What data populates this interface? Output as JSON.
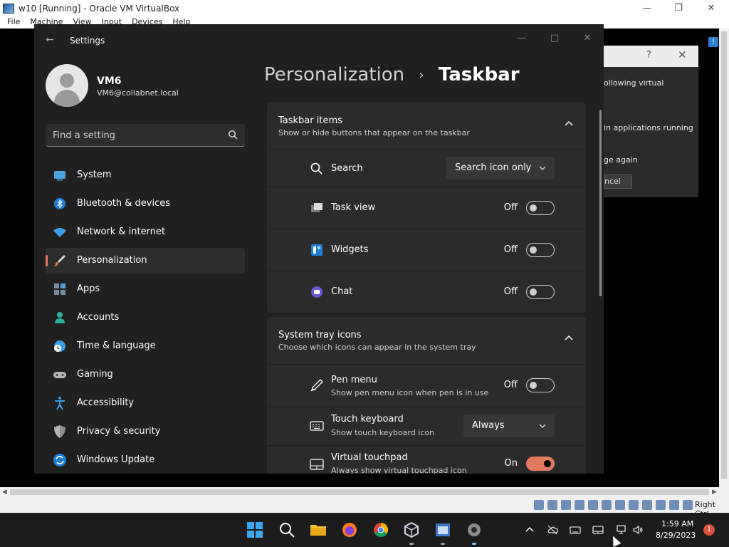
{
  "host": {
    "title": "w10 [Running] - Oracle VM VirtualBox",
    "menu": [
      "File",
      "Machine",
      "View",
      "Input",
      "Devices",
      "Help"
    ],
    "status_right": "Right Ctrl"
  },
  "bg_dialog": {
    "help": "?",
    "line1": "ollowing virtual",
    "line2": "in applications running",
    "line3": "ge again",
    "cancel": "ncel"
  },
  "settings": {
    "window_title": "Settings",
    "user": {
      "name": "VM6",
      "email": "VM6@collabnet.local"
    },
    "search": {
      "placeholder": "Find a setting"
    },
    "nav": [
      {
        "label": "System",
        "icon": "system-icon"
      },
      {
        "label": "Bluetooth & devices",
        "icon": "bluetooth-icon"
      },
      {
        "label": "Network & internet",
        "icon": "wifi-icon"
      },
      {
        "label": "Personalization",
        "icon": "brush-icon",
        "active": true
      },
      {
        "label": "Apps",
        "icon": "apps-icon"
      },
      {
        "label": "Accounts",
        "icon": "accounts-icon"
      },
      {
        "label": "Time & language",
        "icon": "clock-globe-icon"
      },
      {
        "label": "Gaming",
        "icon": "gamepad-icon"
      },
      {
        "label": "Accessibility",
        "icon": "accessibility-icon"
      },
      {
        "label": "Privacy & security",
        "icon": "shield-icon"
      },
      {
        "label": "Windows Update",
        "icon": "update-icon"
      }
    ],
    "breadcrumb": {
      "parent": "Personalization",
      "separator": "›",
      "current": "Taskbar"
    },
    "taskbar_items": {
      "title": "Taskbar items",
      "subtitle": "Show or hide buttons that appear on the taskbar",
      "rows": [
        {
          "label": "Search",
          "value": "Search icon only",
          "icon": "search-icon"
        },
        {
          "label": "Task view",
          "state": "Off",
          "on": false,
          "icon": "task-view-icon"
        },
        {
          "label": "Widgets",
          "state": "Off",
          "on": false,
          "icon": "widgets-icon"
        },
        {
          "label": "Chat",
          "state": "Off",
          "on": false,
          "icon": "chat-icon"
        }
      ]
    },
    "system_tray": {
      "title": "System tray icons",
      "subtitle": "Choose which icons can appear in the system tray",
      "rows": [
        {
          "label": "Pen menu",
          "sub": "Show pen menu icon when pen is in use",
          "state": "Off",
          "on": false,
          "icon": "pen-icon"
        },
        {
          "label": "Touch keyboard",
          "sub": "Show touch keyboard icon",
          "value": "Always",
          "icon": "keyboard-icon"
        },
        {
          "label": "Virtual touchpad",
          "sub": "Always show virtual touchpad icon",
          "state": "On",
          "on": true,
          "icon": "touchpad-icon"
        }
      ]
    }
  },
  "guest_taskbar": {
    "time": "1:59 AM",
    "date": "8/29/2023",
    "notifications": "1"
  },
  "colors": {
    "accent": "#e37a60",
    "window_bg": "#202020",
    "card_bg": "#2b2b2b"
  }
}
